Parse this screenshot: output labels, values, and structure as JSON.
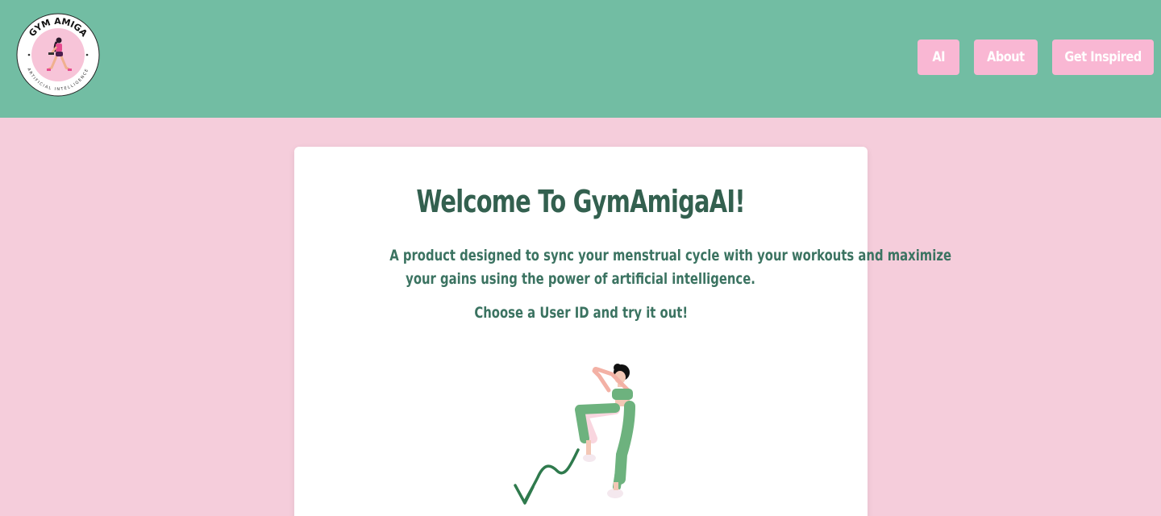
{
  "header": {
    "logo": {
      "text_top": "GYM AMIGA",
      "text_bottom": "ARTIFICIAL INTELLIGENCE",
      "icon": "woman-lifting-dumbbell-logo"
    },
    "nav": [
      {
        "label": "AI"
      },
      {
        "label": "About"
      },
      {
        "label": "Get Inspired"
      }
    ],
    "colors": {
      "background": "#72bda3",
      "button": "#f9b7d3",
      "button_text": "#ffffff"
    }
  },
  "main": {
    "title": "Welcome To GymAmigaAI!",
    "description": "A product designed to sync your menstrual cycle with your workouts and maximize your gains using the power of artificial intelligence.",
    "description_line1": "A product designed to sync your menstrual cycle with your workouts and maximize",
    "description_line2": "your gains using the power of artificial intelligence.",
    "prompt": "Choose a User ID and try it out!",
    "illustration": "woman-exercising-high-knee-icon",
    "arrow": "squiggle-down-arrow-icon",
    "colors": {
      "page_background": "#f5cddb",
      "card_background": "#ffffff",
      "text": "#33604f"
    }
  }
}
